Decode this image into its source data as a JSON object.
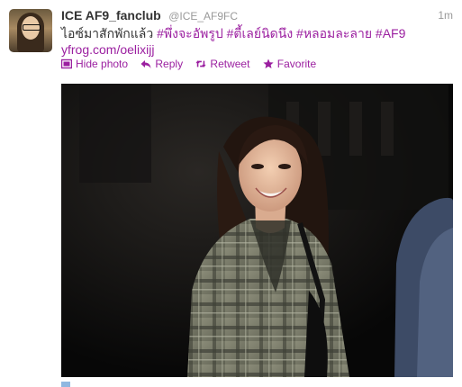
{
  "tweet": {
    "fullname": "ICE AF9_fanclub",
    "username": "@ICE_AF9FC",
    "time": "1m",
    "text_plain": "ไอซ์มาสักพักแล้ว",
    "hashtags": [
      "#พึ่งจะอัพรูป",
      "#ตี้เลย์นิดนึง",
      "#หลอมละลาย",
      "#AF9"
    ],
    "link": "yfrog.com/oelixijj"
  },
  "actions": {
    "hide_photo": "Hide photo",
    "reply": "Reply",
    "retweet": "Retweet",
    "favorite": "Favorite"
  },
  "colors": {
    "accent": "#9b1fa0",
    "name": "#333333",
    "meta": "#999999"
  },
  "icons": {
    "hide_photo": "photo-icon",
    "reply": "reply-arrow-icon",
    "retweet": "retweet-icon",
    "favorite": "star-icon"
  }
}
